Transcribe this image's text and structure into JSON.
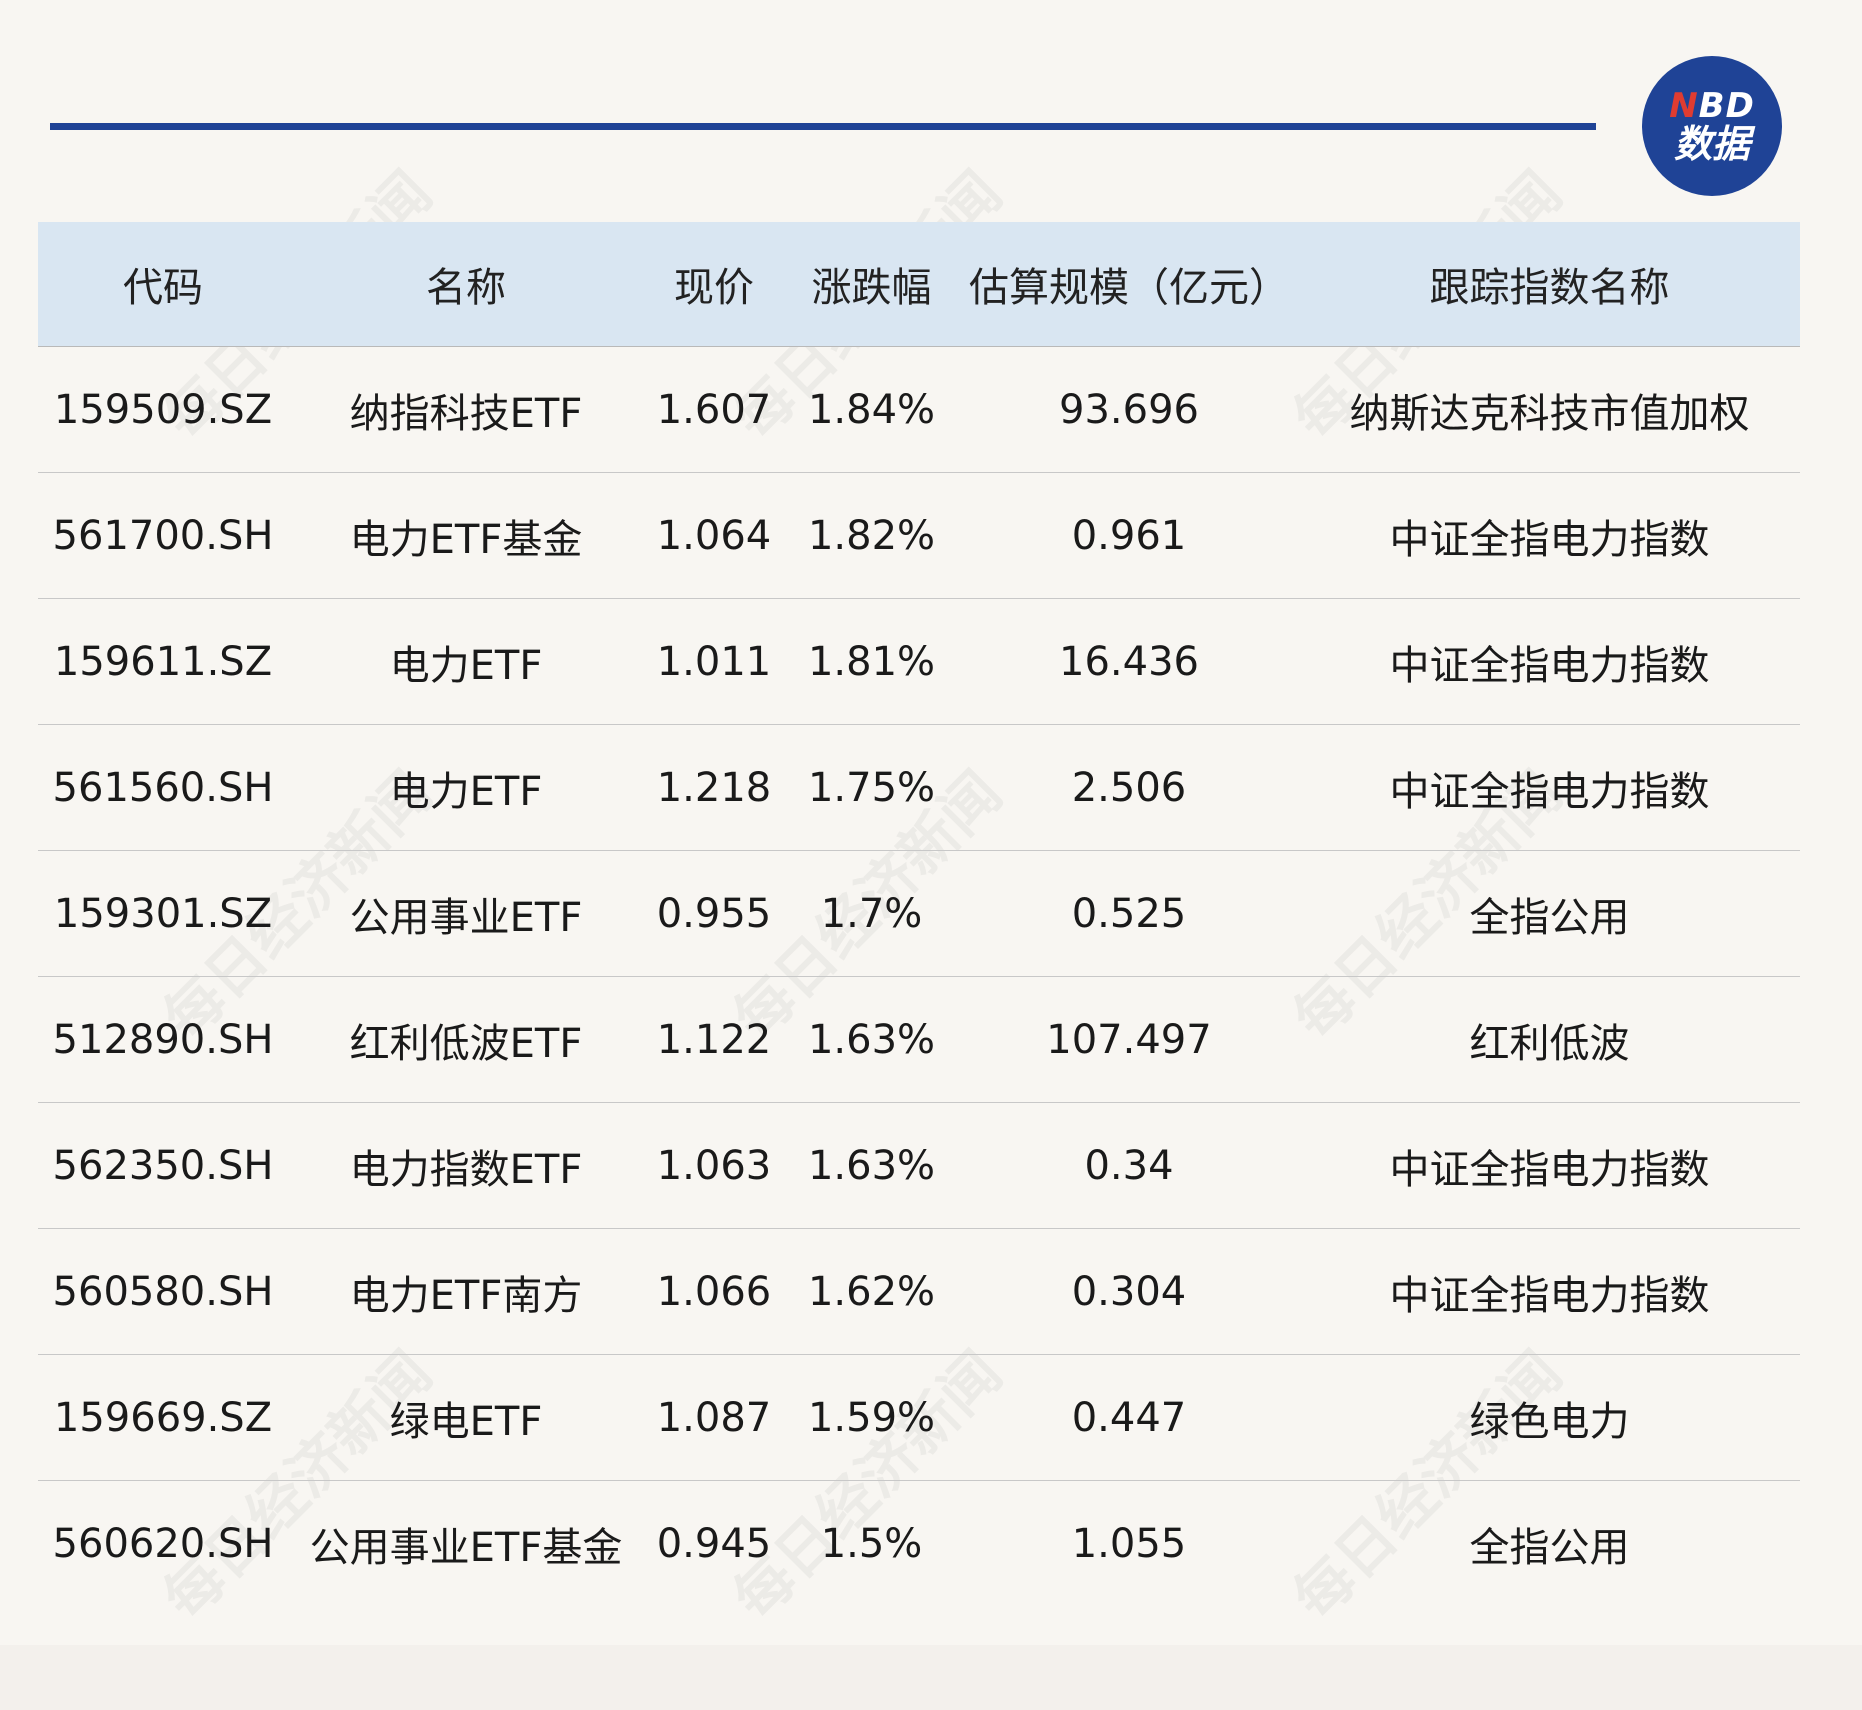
{
  "logo": {
    "line1_accent": "N",
    "line1_rest": "BD",
    "line2": "数据"
  },
  "watermark_text": "每日经济新闻",
  "table": {
    "headers": [
      "代码",
      "名称",
      "现价",
      "涨跌幅",
      "估算规模（亿元）",
      "跟踪指数名称"
    ],
    "rows": [
      [
        "159509.SZ",
        "纳指科技ETF",
        "1.607",
        "1.84%",
        "93.696",
        "纳斯达克科技市值加权"
      ],
      [
        "561700.SH",
        "电力ETF基金",
        "1.064",
        "1.82%",
        "0.961",
        "中证全指电力指数"
      ],
      [
        "159611.SZ",
        "电力ETF",
        "1.011",
        "1.81%",
        "16.436",
        "中证全指电力指数"
      ],
      [
        "561560.SH",
        "电力ETF",
        "1.218",
        "1.75%",
        "2.506",
        "中证全指电力指数"
      ],
      [
        "159301.SZ",
        "公用事业ETF",
        "0.955",
        "1.7%",
        "0.525",
        "全指公用"
      ],
      [
        "512890.SH",
        "红利低波ETF",
        "1.122",
        "1.63%",
        "107.497",
        "红利低波"
      ],
      [
        "562350.SH",
        "电力指数ETF",
        "1.063",
        "1.63%",
        "0.34",
        "中证全指电力指数"
      ],
      [
        "560580.SH",
        "电力ETF南方",
        "1.066",
        "1.62%",
        "0.304",
        "中证全指电力指数"
      ],
      [
        "159669.SZ",
        "绿电ETF",
        "1.087",
        "1.59%",
        "0.447",
        "绿色电力"
      ],
      [
        "560620.SH",
        "公用事业ETF基金",
        "0.945",
        "1.5%",
        "1.055",
        "全指公用"
      ]
    ]
  }
}
